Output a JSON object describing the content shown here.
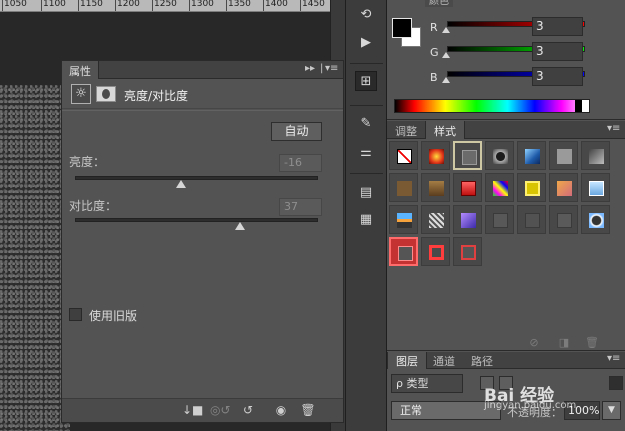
{
  "ruler": {
    "ticks": [
      "1050",
      "1100",
      "1150",
      "1200",
      "1250",
      "1300",
      "1350",
      "1400",
      "1450"
    ]
  },
  "properties": {
    "tab_label": "属性",
    "header_title": "亮度/对比度",
    "auto_label": "自动",
    "brightness_label": "亮度：",
    "brightness_value": "-16",
    "contrast_label": "对比度：",
    "contrast_value": "37",
    "legacy_label": "使用旧版",
    "legacy_checked": false
  },
  "color_panel": {
    "tab_hint": "颜色",
    "channels": [
      {
        "label": "R",
        "value": "3"
      },
      {
        "label": "G",
        "value": "3"
      },
      {
        "label": "B",
        "value": "3"
      }
    ],
    "foreground": "#000000",
    "background": "#ffffff"
  },
  "styles_panel": {
    "tabs": [
      "调整",
      "样式"
    ],
    "active_tab": "样式"
  },
  "layers_panel": {
    "tabs": [
      "图层",
      "通道",
      "路径"
    ],
    "filter_label": "ρ 类型",
    "blend_mode": "正常",
    "opacity_label": "不透明度：",
    "opacity_value": "100%",
    "watermark_text": "Bai 经验",
    "watermark_sub": "jingyan.baidu.com"
  }
}
